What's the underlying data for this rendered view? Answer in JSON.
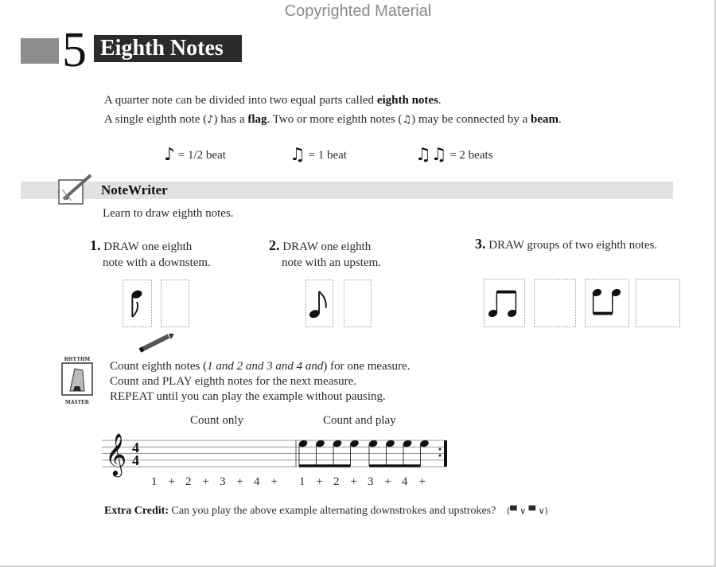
{
  "watermark": "Copyrighted Material",
  "chapter": {
    "number": "5",
    "title": "Eighth Notes"
  },
  "intro": {
    "line1_pre": "A quarter note can be divided into two equal parts called ",
    "line1_bold": "eighth notes",
    "line1_post": ".",
    "line2_a": "A single eighth note (",
    "line2_b": ") has a ",
    "line2_flag": "flag",
    "line2_c": ". Two or more eighth notes (",
    "line2_d": ") may be connected by a ",
    "line2_beam": "beam",
    "line2_e": ".",
    "single_note_glyph": "♪",
    "beamed_glyph": "♫"
  },
  "note_values": [
    {
      "symbol": "♪",
      "label": "= 1/2 beat"
    },
    {
      "symbol": "♫",
      "label": "= 1 beat"
    },
    {
      "symbol": "♫♫",
      "label": "= 2 beats"
    }
  ],
  "notewriter": {
    "title": "NoteWriter",
    "subtitle": "Learn to draw eighth notes.",
    "steps": [
      {
        "num": "1.",
        "line1": "DRAW one eighth",
        "line2": "note with a downstem."
      },
      {
        "num": "2.",
        "line1": "DRAW one eighth",
        "line2": "note with an upstem."
      },
      {
        "num": "3.",
        "line1": "DRAW groups of two eighth notes.",
        "line2": ""
      }
    ]
  },
  "rhythm_master": {
    "icon_top": "RHYTHM",
    "icon_bottom": "MASTER",
    "line1_pre": "Count eighth notes (",
    "line1_italic": "1 and 2 and 3 and 4 and",
    "line1_post": ") for one measure.",
    "line2": "Count and PLAY eighth notes for the next measure.",
    "line3": "REPEAT until you can play the example without pausing."
  },
  "staff": {
    "time_signature": {
      "top": "4",
      "bottom": "4"
    },
    "measure1_label": "Count only",
    "measure2_label": "Count and play",
    "counts_measure1": [
      "1",
      "+",
      "2",
      "+",
      "3",
      "+",
      "4",
      "+"
    ],
    "counts_measure2": [
      "1",
      "+",
      "2",
      "+",
      "3",
      "+",
      "4",
      "+"
    ],
    "measure2_note_count": 8
  },
  "extra_credit": {
    "label": "Extra Credit:",
    "text": " Can you play the above example alternating downstrokes and upstrokes?",
    "strokes": "(▀ ∨ ▀ ∨)"
  }
}
